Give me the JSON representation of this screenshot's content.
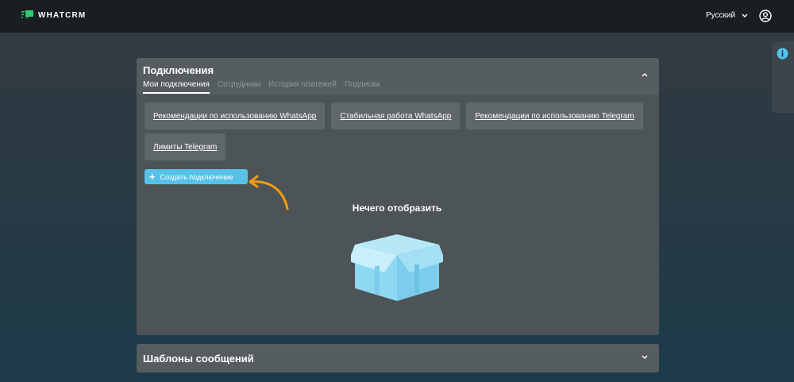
{
  "header": {
    "logo_text": "WHATCRM",
    "language": "Русский",
    "icons": {
      "logo": "chat-logo-icon",
      "language_chevron": "chevron-down-icon",
      "user": "user-circle-icon",
      "info": "info-icon"
    }
  },
  "connections_panel": {
    "title": "Подключения",
    "tabs": [
      {
        "label": "Мои подключения",
        "active": true
      },
      {
        "label": "Сотрудники",
        "active": false
      },
      {
        "label": "История платежей",
        "active": false
      },
      {
        "label": "Подписки",
        "active": false
      }
    ],
    "links": [
      "Рекомендации по использованию WhatsApp",
      "Стабильная работа WhatsApp",
      "Рекомендации по использованию Telegram",
      "Лимиты Telegram"
    ],
    "create_button": "Создать подключение",
    "empty_state": "Нечего отобразить"
  },
  "templates_panel": {
    "title": "Шаблоны сообщений"
  },
  "colors": {
    "accent": "#56c2e8",
    "arrow": "#f39c12",
    "logo_green": "#2ecc71",
    "box": "#8fd8f2"
  }
}
